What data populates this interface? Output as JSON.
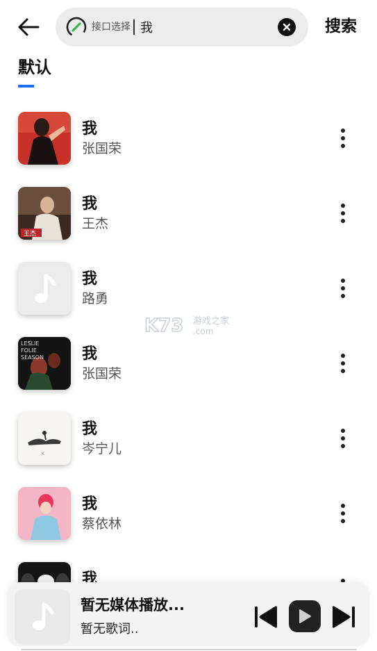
{
  "header": {
    "back_icon": "arrow-left-icon",
    "api_icon": "link-icon",
    "api_label": "接口选择",
    "search_value": "我",
    "clear_icon": "close-circle-icon",
    "search_button": "搜索"
  },
  "tabs": [
    {
      "label": "默认",
      "active": true
    }
  ],
  "songs": [
    {
      "title": "我",
      "artist": "张国荣"
    },
    {
      "title": "我",
      "artist": "王杰"
    },
    {
      "title": "我",
      "artist": "路勇"
    },
    {
      "title": "我",
      "artist": "张国荣"
    },
    {
      "title": "我",
      "artist": "岑宁儿"
    },
    {
      "title": "我",
      "artist": "蔡依林"
    },
    {
      "title": "我",
      "artist": ""
    }
  ],
  "player": {
    "title": "暂无媒体播放...",
    "lyrics": "暂无歌词..",
    "cover_icon": "music-note-icon",
    "prev_icon": "skip-previous-icon",
    "play_icon": "play-icon",
    "next_icon": "skip-next-icon"
  },
  "watermark": {
    "logo": "K73",
    "text": "游戏之家",
    "domain": ".com"
  },
  "colors": {
    "accent": "#1a6ff0",
    "search_bg": "#ececec",
    "player_bg": "#f3f3f3"
  }
}
